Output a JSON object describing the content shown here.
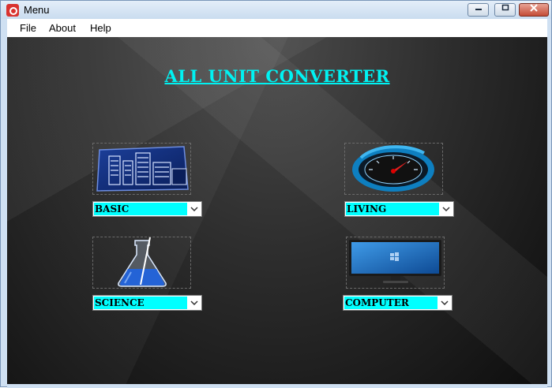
{
  "window": {
    "title": "Menu",
    "icon": "app-icon"
  },
  "menu": {
    "items": [
      "File",
      "About",
      "Help"
    ]
  },
  "app": {
    "title": "ALL UNIT CONVERTER",
    "categories": [
      {
        "image": "building-icon",
        "selected": "BASIC"
      },
      {
        "image": "speedometer-icon",
        "selected": "LIVING"
      },
      {
        "image": "flask-icon",
        "selected": "SCIENCE"
      },
      {
        "image": "monitor-icon",
        "selected": "COMPUTER"
      }
    ]
  },
  "colors": {
    "title": "#00f2f2",
    "combo_fill": "#00ffff",
    "background": "#1a1a1a"
  }
}
